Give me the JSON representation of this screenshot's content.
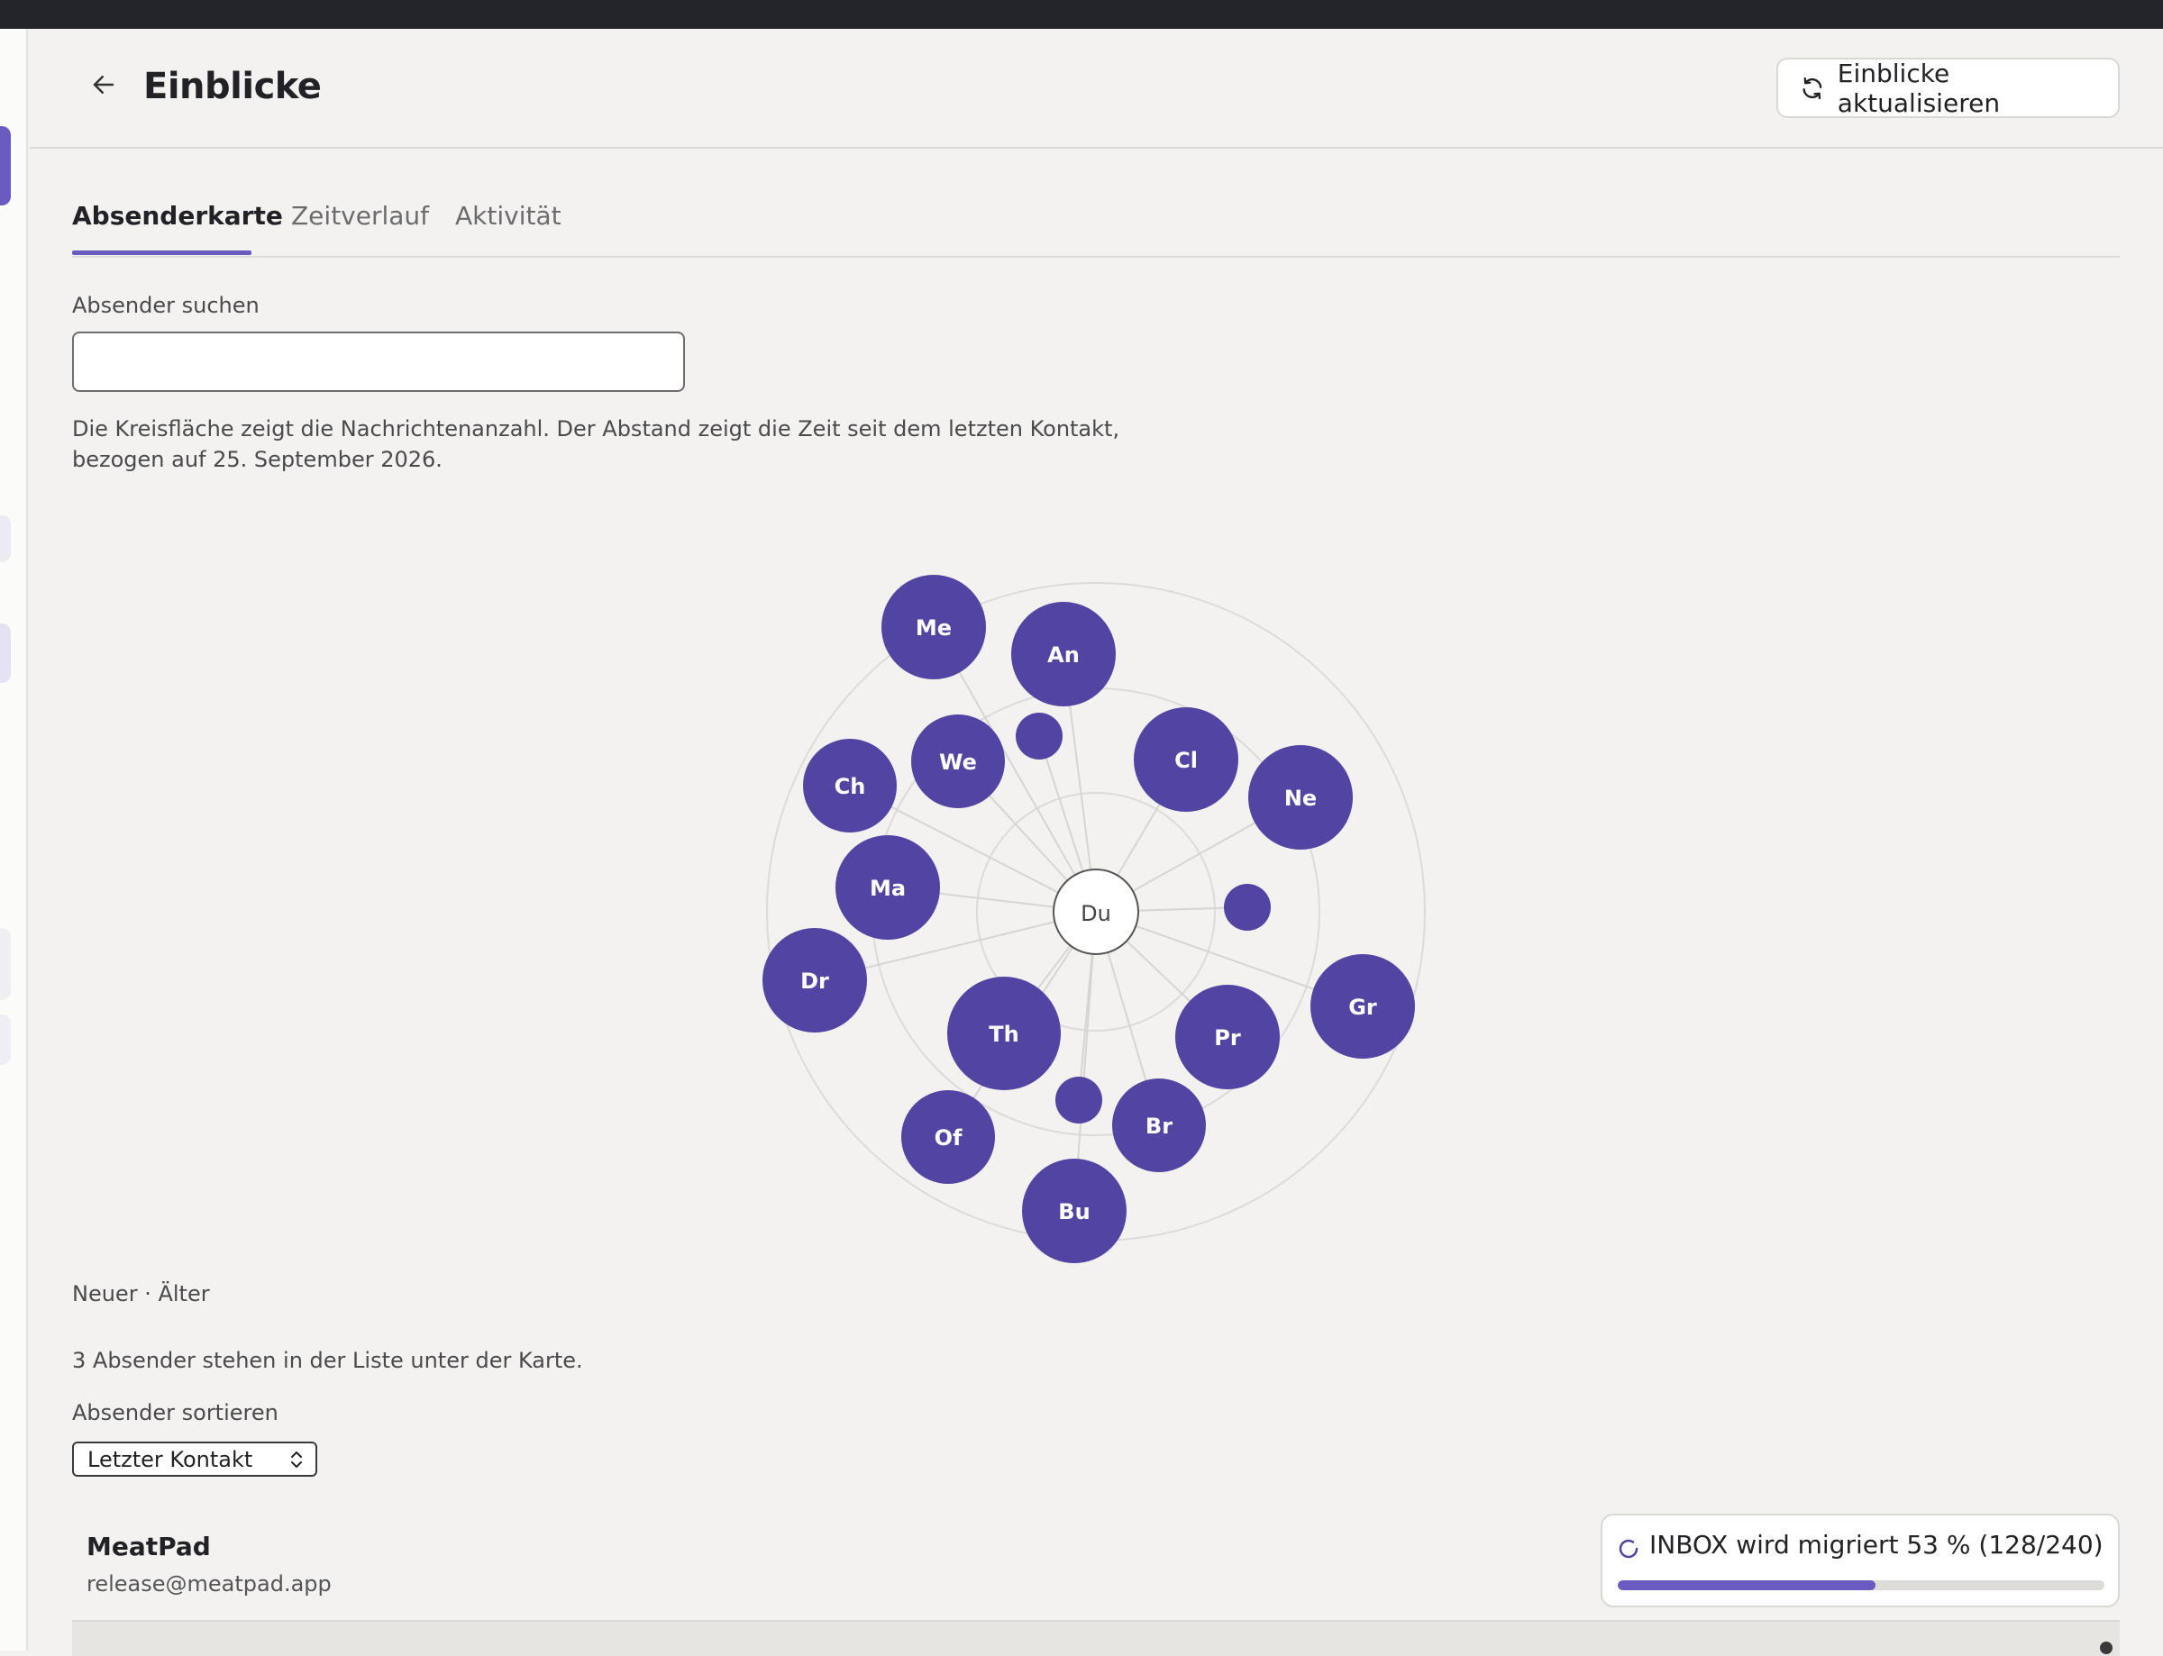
{
  "header": {
    "title": "Einblicke",
    "refresh_label": "Einblicke aktualisieren"
  },
  "tabs": [
    {
      "label": "Absenderkarte",
      "active": true
    },
    {
      "label": "Zeitverlauf",
      "active": false
    },
    {
      "label": "Aktivität",
      "active": false
    }
  ],
  "search": {
    "label": "Absender suchen",
    "value": "",
    "placeholder": ""
  },
  "description": "Die Kreisfläche zeigt die Nachrichtenanzahl. Der Abstand zeigt die Zeit seit dem letzten Kontakt, bezogen auf 25. September 2026.",
  "map": {
    "center_label": "Du",
    "accent_color": "#5144a3",
    "senders": [
      "Me",
      "An",
      "Ch",
      "We",
      "",
      "Cl",
      "Ne",
      "Ma",
      "",
      "Dr",
      "Gr",
      "Th",
      "Pr",
      "",
      "Br",
      "Of",
      "Bu"
    ]
  },
  "legend": "Neuer · Älter",
  "list_note": "3 Absender stehen in der Liste unter der Karte.",
  "sort": {
    "label": "Absender sortieren",
    "selected": "Letzter Kontakt"
  },
  "list": [
    {
      "name": "MeatPad",
      "email": "release@meatpad.app"
    }
  ],
  "toast": {
    "text": "INBOX wird migriert 53 % (128/240)",
    "progress": 0.53
  },
  "icons": {
    "back": "arrow-left-icon",
    "refresh": "refresh-icon",
    "sort": "chevron-up-down-icon",
    "spinner": "spinner-icon"
  }
}
